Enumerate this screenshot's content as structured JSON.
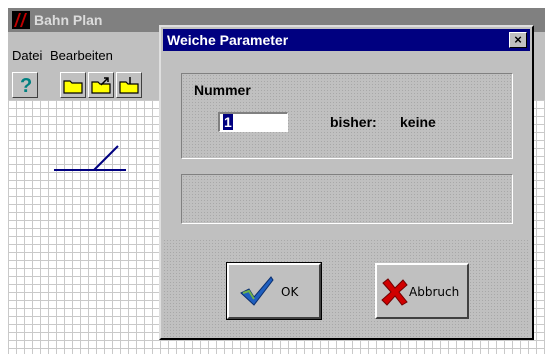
{
  "app": {
    "title": "Bahn Plan",
    "menu": [
      "Datei",
      "Bearbeiten"
    ]
  },
  "dialog": {
    "title": "Weiche Parameter",
    "close_glyph": "×",
    "nummer_label": "Nummer",
    "nummer_value": "1",
    "bisher_label": "bisher:",
    "bisher_value": "keine",
    "ok_label": "OK",
    "cancel_label": "Abbruch"
  },
  "icons": {
    "help": "question-icon",
    "open": "folder-open-icon",
    "ok": "checkmark-icon",
    "cancel": "red-x-icon"
  }
}
